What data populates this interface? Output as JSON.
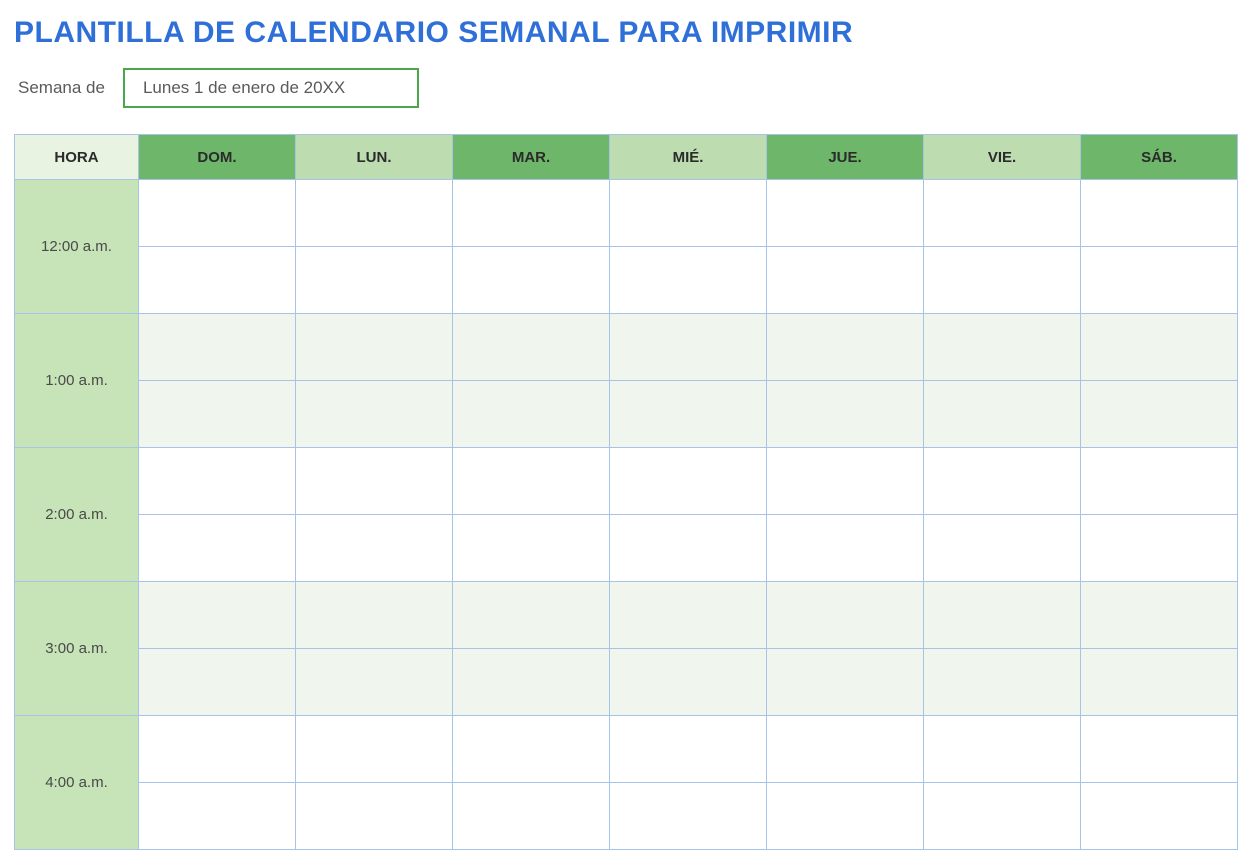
{
  "title": "PLANTILLA DE CALENDARIO SEMANAL PARA IMPRIMIR",
  "week": {
    "label": "Semana de",
    "value": "Lunes 1 de enero de 20XX"
  },
  "headers": {
    "time": "HORA",
    "days": [
      "DOM.",
      "LUN.",
      "MAR.",
      "MIÉ.",
      "JUE.",
      "VIE.",
      "SÁB."
    ]
  },
  "hours": [
    "12:00 a.m.",
    "1:00 a.m.",
    "2:00 a.m.",
    "3:00 a.m.",
    "4:00 a.m."
  ]
}
